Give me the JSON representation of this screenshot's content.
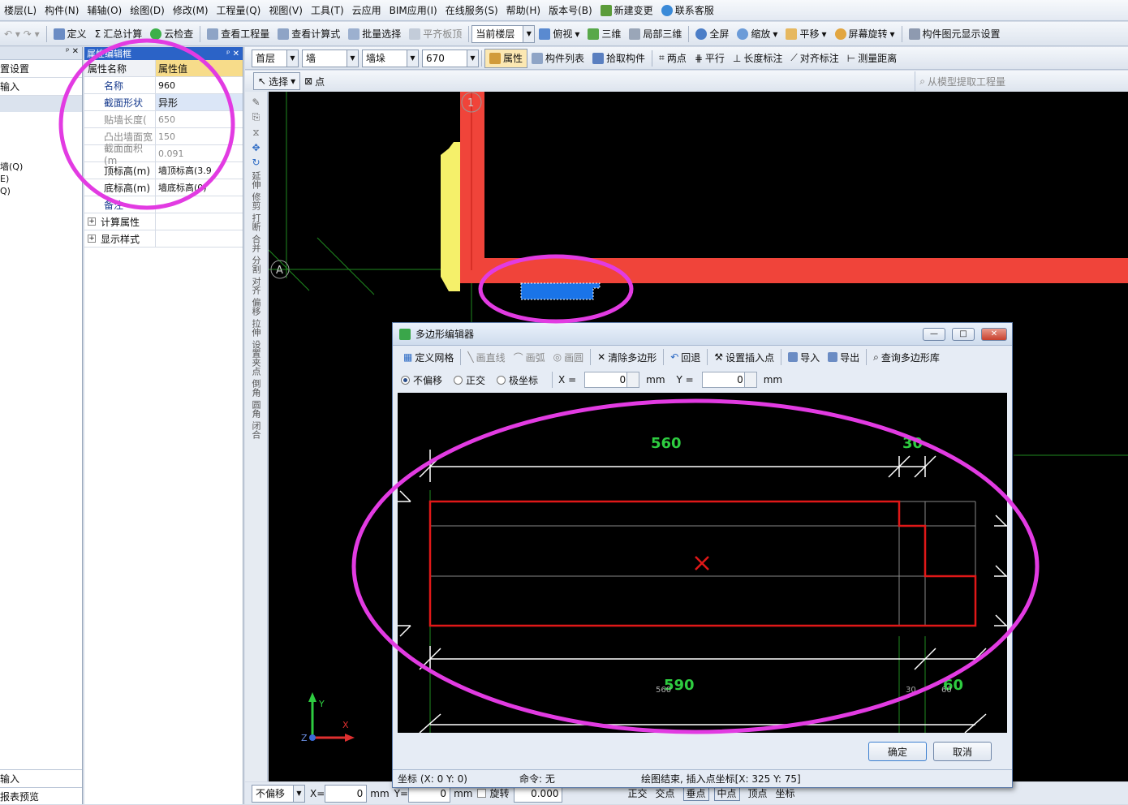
{
  "menu": [
    "楼层(L)",
    "构件(N)",
    "辅轴(O)",
    "绘图(D)",
    "修改(M)",
    "工程量(Q)",
    "视图(V)",
    "工具(T)",
    "云应用",
    "BIM应用(I)",
    "在线服务(S)",
    "帮助(H)",
    "版本号(B)",
    "新建变更",
    "联系客服"
  ],
  "toolbar1": {
    "define": "定义",
    "summary": "汇总计算",
    "cloud_check": "云检查",
    "view_quantity": "查看工程量",
    "view_formula": "查看计算式",
    "batch_select": "批量选择",
    "flat_slab": "平齐板顶",
    "floor_combo": "当前楼层",
    "top_view": "俯视",
    "three_d": "三维",
    "local_3d": "局部三维",
    "fullscreen": "全屏",
    "zoom": "缩放",
    "pan": "平移",
    "rotate": "屏幕旋转",
    "display_settings": "构件图元显示设置"
  },
  "left_panel": {
    "item1": "置设置",
    "item2": "输入",
    "item3": "墙(Q)",
    "item4": "E)",
    "item5": "Q)",
    "bottom1": "输入",
    "bottom2": "报表预览"
  },
  "props": {
    "title": "属性编辑框",
    "header_name": "属性名称",
    "header_value": "属性值",
    "rows": [
      {
        "name": "名称",
        "value": "960"
      },
      {
        "name": "截面形状",
        "value": "异形"
      },
      {
        "name": "贴墙长度(",
        "value": "650"
      },
      {
        "name": "凸出墙面宽",
        "value": "150"
      },
      {
        "name": "截面面积(m",
        "value": "0.091"
      },
      {
        "name": "顶标高(m)",
        "value": "墙顶标高(3.9"
      },
      {
        "name": "底标高(m)",
        "value": "墙底标高(0)"
      },
      {
        "name": "备注",
        "value": ""
      },
      {
        "name": "计算属性",
        "value": ""
      },
      {
        "name": "显示样式",
        "value": ""
      }
    ]
  },
  "toolbar2": {
    "floor": "首层",
    "type": "墙",
    "subtype": "墙垛",
    "value": "670",
    "attr": "属性",
    "list": "构件列表",
    "pick": "拾取构件",
    "twopoint": "两点",
    "parallel": "平行",
    "length_dim": "长度标注",
    "align_dim": "对齐标注",
    "measure": "测量距离"
  },
  "toolbar3": {
    "select": "选择",
    "point": "点",
    "extract": "从模型提取工程量"
  },
  "vtools": [
    "延伸",
    "修剪",
    "打断",
    "合并",
    "分割",
    "对齐",
    "偏移",
    "拉伸",
    "设置夹点",
    "倒角",
    "圆角",
    "闭合"
  ],
  "canvas": {
    "axis_1": "1",
    "axis_a": "A",
    "y_label": "Y",
    "x_label": "X",
    "z_label": "Z"
  },
  "statusbar": {
    "offset": "不偏移",
    "x": "X=",
    "xval": "0",
    "mm": "mm",
    "y": "Y=",
    "yval": "0",
    "mm2": "mm",
    "rotate": "旋转",
    "angle": "0.000",
    "snap1": "正交",
    "snap2": "交点",
    "snap3": "垂点",
    "snap4": "中点",
    "snap5": "顶点",
    "snap6": "坐标"
  },
  "dialog": {
    "title": "多边形编辑器",
    "tools": [
      "定义网格",
      "画直线",
      "画弧",
      "画圆",
      "清除多边形",
      "回退",
      "设置插入点",
      "导入",
      "导出",
      "查询多边形库"
    ],
    "radio1": "不偏移",
    "radio2": "正交",
    "radio3": "极坐标",
    "x_label": "X =",
    "x_val": "0",
    "mm1": "mm",
    "y_label": "Y =",
    "y_val": "0",
    "mm2": "mm",
    "dim_top": "560",
    "dim_top_right": "30",
    "dim_bottom": "590",
    "dim_bottom_right": "60",
    "small_560": "560",
    "small_30": "30",
    "small_60": "60",
    "ok": "确定",
    "cancel": "取消",
    "status_coord": "坐标 (X: 0 Y: 0)",
    "status_cmd": "命令: 无",
    "status_msg": "绘图结束, 插入点坐标[X: 325 Y: 75]"
  },
  "colors": {
    "highlight": "#e23be2",
    "wall_red": "#f0443a",
    "column_yellow": "#f5f06a",
    "selection_blue": "#1a74e8"
  }
}
